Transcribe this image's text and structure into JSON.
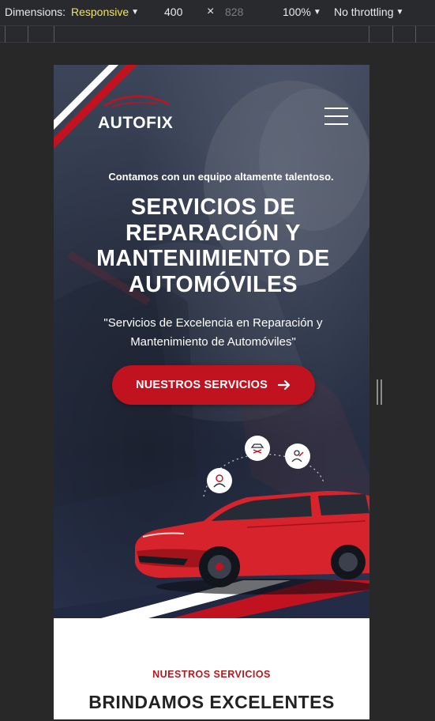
{
  "devtools": {
    "dimensions_label": "Dimensions:",
    "dimensions_value": "Responsive",
    "width": "400",
    "times": "×",
    "height": "828",
    "zoom": "100%",
    "throttling": "No throttling",
    "accent_color": "#f4e45a"
  },
  "site": {
    "logo_text": "AUTOFIX",
    "brand_color": "#c1121f",
    "nav": {
      "menu_icon": "hamburger-menu-icon"
    },
    "hero": {
      "tagline": "Contamos con un equipo altamente talentoso.",
      "title_lines": [
        "SERVICIOS DE",
        "REPARACIÓN Y",
        "MANTENIMIENTO DE",
        "AUTOMÓVILES"
      ],
      "subtitle_lines": [
        "\"Servicios de Excelencia en Reparación y",
        "Mantenimiento de Automóviles\""
      ],
      "cta_label": "NUESTROS SERVICIOS",
      "cta_icon": "arrow-right-icon",
      "service_icons": [
        "mechanic-icon",
        "car-lift-icon",
        "technician-icon"
      ]
    },
    "services": {
      "eyebrow": "NUESTROS SERVICIOS",
      "title": "BRINDAMOS EXCELENTES"
    }
  }
}
